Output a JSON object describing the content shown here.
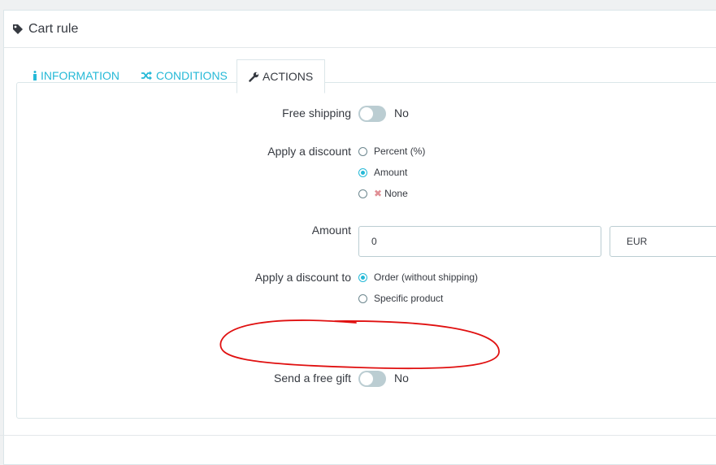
{
  "panel": {
    "title": "Cart rule",
    "title_icon": "tag-icon"
  },
  "tabs": [
    {
      "label": "INFORMATION",
      "icon": "info-icon",
      "active": false
    },
    {
      "label": "CONDITIONS",
      "icon": "shuffle-icon",
      "active": false
    },
    {
      "label": "ACTIONS",
      "icon": "wrench-icon",
      "active": true
    }
  ],
  "actions": {
    "free_shipping": {
      "label": "Free shipping",
      "value": "No"
    },
    "apply_discount": {
      "label": "Apply a discount",
      "options": [
        "Percent (%)",
        "Amount",
        "None"
      ],
      "selected": "Amount"
    },
    "amount": {
      "label": "Amount",
      "value": "0",
      "currency": "EUR"
    },
    "apply_discount_to": {
      "label": "Apply a discount to",
      "options": [
        "Order (without shipping)",
        "Specific product"
      ],
      "selected": "Order (without shipping)"
    },
    "free_gift": {
      "label": "Send a free gift",
      "value": "No"
    }
  },
  "colors": {
    "accent": "#25b9d7",
    "switch_off": "#bbcdd2",
    "annotation": "#e01010",
    "none_x": "#e08f95"
  }
}
